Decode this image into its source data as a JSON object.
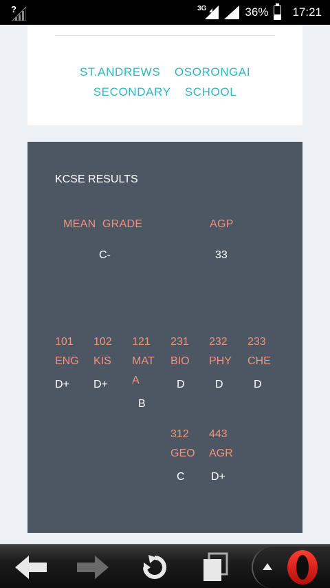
{
  "status_bar": {
    "network_label": "3G",
    "battery": "36%",
    "battery_level": 0.36,
    "time": "17:21"
  },
  "school": {
    "name_line1": "ST.ANDREWS  OSORONGAI",
    "name_line2": "SECONDARY  SCHOOL"
  },
  "results": {
    "title": "KCSE RESULTS",
    "mean_grade_label": "MEAN  GRADE",
    "mean_grade_value": "C-",
    "agp_label": "AGP",
    "agp_value": "33",
    "subjects": [
      {
        "code": "101",
        "name": "ENG",
        "grade": "D+"
      },
      {
        "code": "102",
        "name": "KIS",
        "grade": "D+"
      },
      {
        "code": "121",
        "name": "MATA",
        "grade": "B"
      },
      {
        "code": "231",
        "name": "BIO",
        "grade": "D"
      },
      {
        "code": "232",
        "name": "PHY",
        "grade": "D"
      },
      {
        "code": "233",
        "name": "CHE",
        "grade": "D"
      },
      {
        "code": "312",
        "name": "GEO",
        "grade": "C"
      },
      {
        "code": "443",
        "name": "AGR",
        "grade": "D+"
      }
    ]
  },
  "colors": {
    "accent_teal": "#2fb7c4",
    "label_salmon": "#f0937d",
    "panel": "#4d5663",
    "opera_red": "#e0201b"
  },
  "browser_bar": {
    "icons": [
      "back-arrow-icon",
      "forward-arrow-icon",
      "reload-icon",
      "tabs-icon",
      "menu-up-icon",
      "opera-logo-icon"
    ]
  }
}
